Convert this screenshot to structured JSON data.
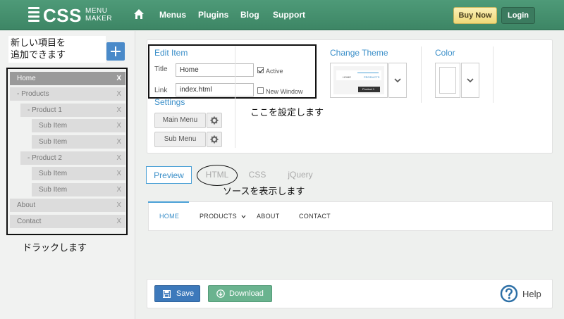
{
  "brand": {
    "logo_main": "CSS",
    "logo_sub_1": "MENU",
    "logo_sub_2": "MAKER"
  },
  "nav": {
    "items": [
      "Menus",
      "Plugins",
      "Blog",
      "Support"
    ],
    "buy_now": "Buy Now",
    "login": "Login"
  },
  "sidebar": {
    "add_label_line1": "新しい項目を",
    "add_label_line2": "追加できます",
    "items": [
      {
        "label": "Home",
        "remove": "X",
        "level": 0,
        "active": true
      },
      {
        "label": "- Products",
        "remove": "X",
        "level": 0
      },
      {
        "label": "- Product 1",
        "remove": "X",
        "level": 1
      },
      {
        "label": "Sub Item",
        "remove": "X",
        "level": 2
      },
      {
        "label": "Sub Item",
        "remove": "X",
        "level": 2
      },
      {
        "label": "- Product 2",
        "remove": "X",
        "level": 1
      },
      {
        "label": "Sub Item",
        "remove": "X",
        "level": 2
      },
      {
        "label": "Sub Item",
        "remove": "X",
        "level": 2
      },
      {
        "label": "About",
        "remove": "X",
        "level": 0
      },
      {
        "label": "Contact",
        "remove": "X",
        "level": 0
      }
    ],
    "drag_label": "ドラックします"
  },
  "edit": {
    "title": "Edit Item",
    "title_label": "Title",
    "title_value": "Home",
    "active_label": "Active",
    "active_checked": true,
    "link_label": "Link",
    "link_value": "index.html",
    "new_window_label": "New Window",
    "new_window_checked": false
  },
  "settings": {
    "title": "Settings",
    "main_menu": "Main Menu",
    "sub_menu": "Sub Menu"
  },
  "theme": {
    "title": "Change Theme",
    "preview_home": "HOME",
    "preview_products": "PRODUCTS",
    "preview_product1": "Product 1"
  },
  "color": {
    "title": "Color"
  },
  "annotations": {
    "settings_note": "ここを設定します",
    "source_note": "ソースを表示します"
  },
  "tabs": [
    "Preview",
    "HTML",
    "CSS",
    "jQuery"
  ],
  "preview_menu": [
    "HOME",
    "PRODUCTS",
    "ABOUT",
    "CONTACT"
  ],
  "footer": {
    "save": "Save",
    "download": "Download",
    "help": "Help"
  },
  "colors": {
    "brand_green": "#3d8665",
    "accent_blue": "#3b8fc9",
    "save_blue": "#3d79bb",
    "download_green": "#6ab38f"
  }
}
